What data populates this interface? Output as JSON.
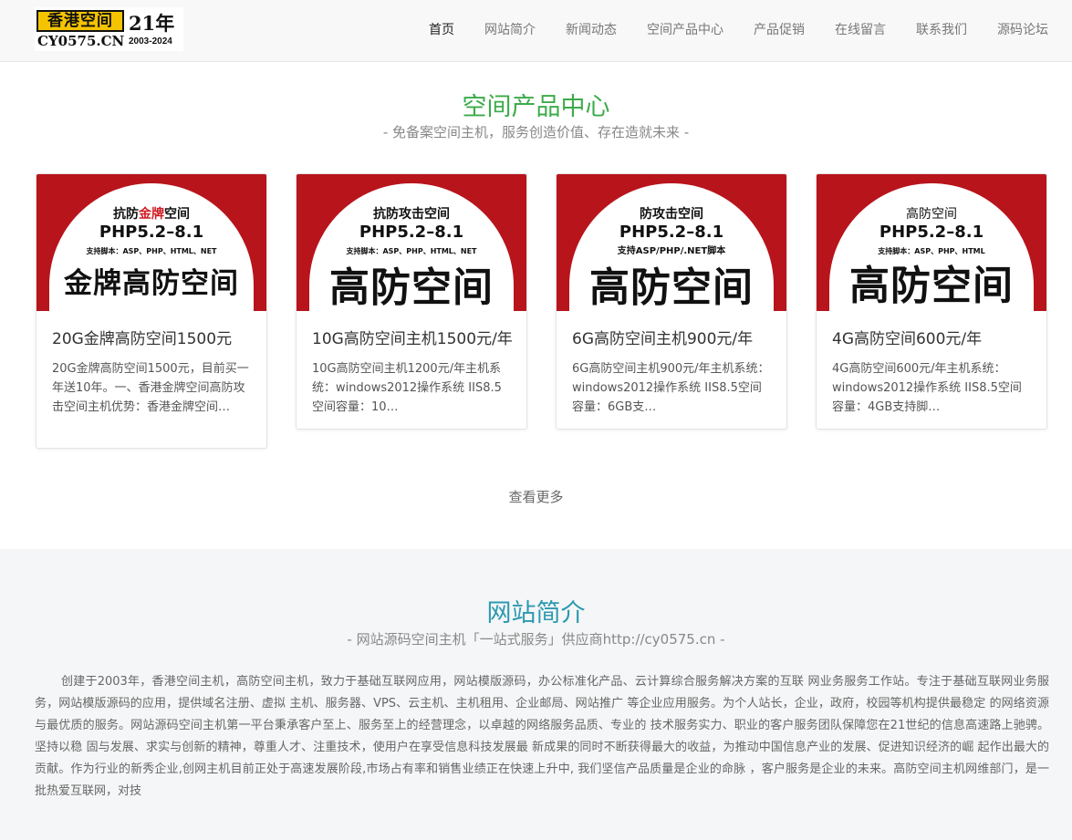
{
  "logo": {
    "name": "香港空间",
    "years": "21年",
    "domain": "CY0575.CN",
    "range": "2003-2024"
  },
  "nav": [
    {
      "label": "首页"
    },
    {
      "label": "网站简介"
    },
    {
      "label": "新闻动态"
    },
    {
      "label": "空间产品中心"
    },
    {
      "label": "产品促销"
    },
    {
      "label": "在线留言"
    },
    {
      "label": "联系我们"
    },
    {
      "label": "源码论坛"
    }
  ],
  "products": {
    "title": "空间产品中心",
    "subtitle": "- 免备案空间主机，服务创造价值、存在造就未来 -",
    "more": "查看更多",
    "cards": [
      {
        "img_line1_a": "抗防",
        "img_line1_hl": "金牌",
        "img_line1_b": "空间",
        "img_line2": "PHP5.2–8.1",
        "img_line3": "支持脚本：ASP、PHP、HTML、NET",
        "img_line4": "金牌高防空间",
        "title": "20G金牌高防空间1500元",
        "desc": "20G金牌高防空间1500元，目前买一年送10年。一、香港金牌空间高防攻击空间主机优势：香港金牌空间…"
      },
      {
        "img_line1_a": "抗防攻击空间",
        "img_line1_hl": "",
        "img_line1_b": "",
        "img_line2": "PHP5.2–8.1",
        "img_line3": "支持脚本：ASP、PHP、HTML、NET",
        "img_line4": "高防空间",
        "title": "10G高防空间主机1500元/年",
        "desc": "10G高防空间主机1200元/年主机系统：windows2012操作系统 IIS8.5空间容量：10…"
      },
      {
        "img_line1_a": "防攻击空间",
        "img_line1_hl": "",
        "img_line1_b": "",
        "img_line2": "PHP5.2–8.1",
        "img_line3": "支持ASP/PHP/.NET脚本",
        "img_line4": "高防空间",
        "title": "6G高防空间主机900元/年",
        "desc": "6G高防空间主机900元/年主机系统：windows2012操作系统 IIS8.5空间容量：6GB支…"
      },
      {
        "img_line1_a": "高防空间",
        "img_line1_hl": "",
        "img_line1_b": "",
        "img_line2": "PHP5.2–8.1",
        "img_line3": "支持脚本：ASP、PHP、HTML",
        "img_line4": "高防空间",
        "title": "4G高防空间600元/年",
        "desc": "4G高防空间600元/年主机系统：windows2012操作系统 IIS8.5空间容量：4GB支持脚…"
      }
    ]
  },
  "about": {
    "title": "网站简介",
    "subtitle": "- 网站源码空间主机「一站式服务」供应商http://cy0575.cn -",
    "text": "创建于2003年，香港空间主机，高防空间主机，致力于基础互联网应用，网站模版源码，办公标准化产品、云计算综合服务解决方案的互联 网业务服务工作站。专注于基础互联网业务服务，网站模版源码的应用，提供域名注册、虚拟 主机、服务器、VPS、云主机、主机租用、企业邮局、网站推广 等企业应用服务。为个人站长，企业，政府，校园等机构提供最稳定 的网络资源与最优质的服务。网站源码空间主机第一平台秉承客户至上、服务至上的经营理念，以卓越的网络服务品质、专业的 技术服务实力、职业的客户服务团队保障您在21世纪的信息高速路上驰骋。坚持以稳 固与发展、求实与创新的精神，尊重人才、注重技术，使用户在享受信息科技发展最 新成果的同时不断获得最大的收益，为推动中国信息产业的发展、促进知识经济的崛 起作出最大的贡献。作为行业的新秀企业,创网主机目前正处于高速发展阶段,市场占有率和销售业绩正在快速上升中, 我们坚信产品质量是企业的命脉 ，客户服务是企业的未来。高防空间主机网维部门，是一批热爱互联网，对技"
  }
}
